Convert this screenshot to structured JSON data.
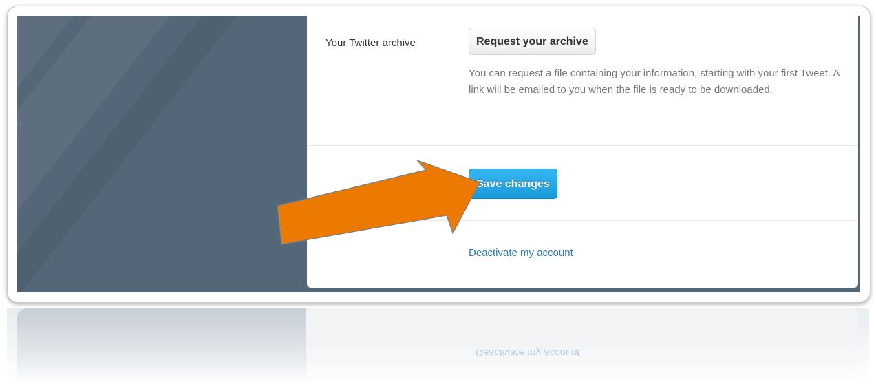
{
  "settings": {
    "archive_label": "Your Twitter archive",
    "request_archive_label": "Request your archive",
    "archive_help_text": "You can request a file containing your information, starting with your first Tweet. A link will be emailed to you when the file is ready to be downloaded.",
    "save_label": "Save changes",
    "deactivate_label": "Deactivate my account"
  },
  "annotation": {
    "arrow_color": "#ec7a00"
  },
  "colors": {
    "background_panel": "#536778",
    "primary_button": "#1da1f2",
    "link": "#2b7bb9"
  }
}
